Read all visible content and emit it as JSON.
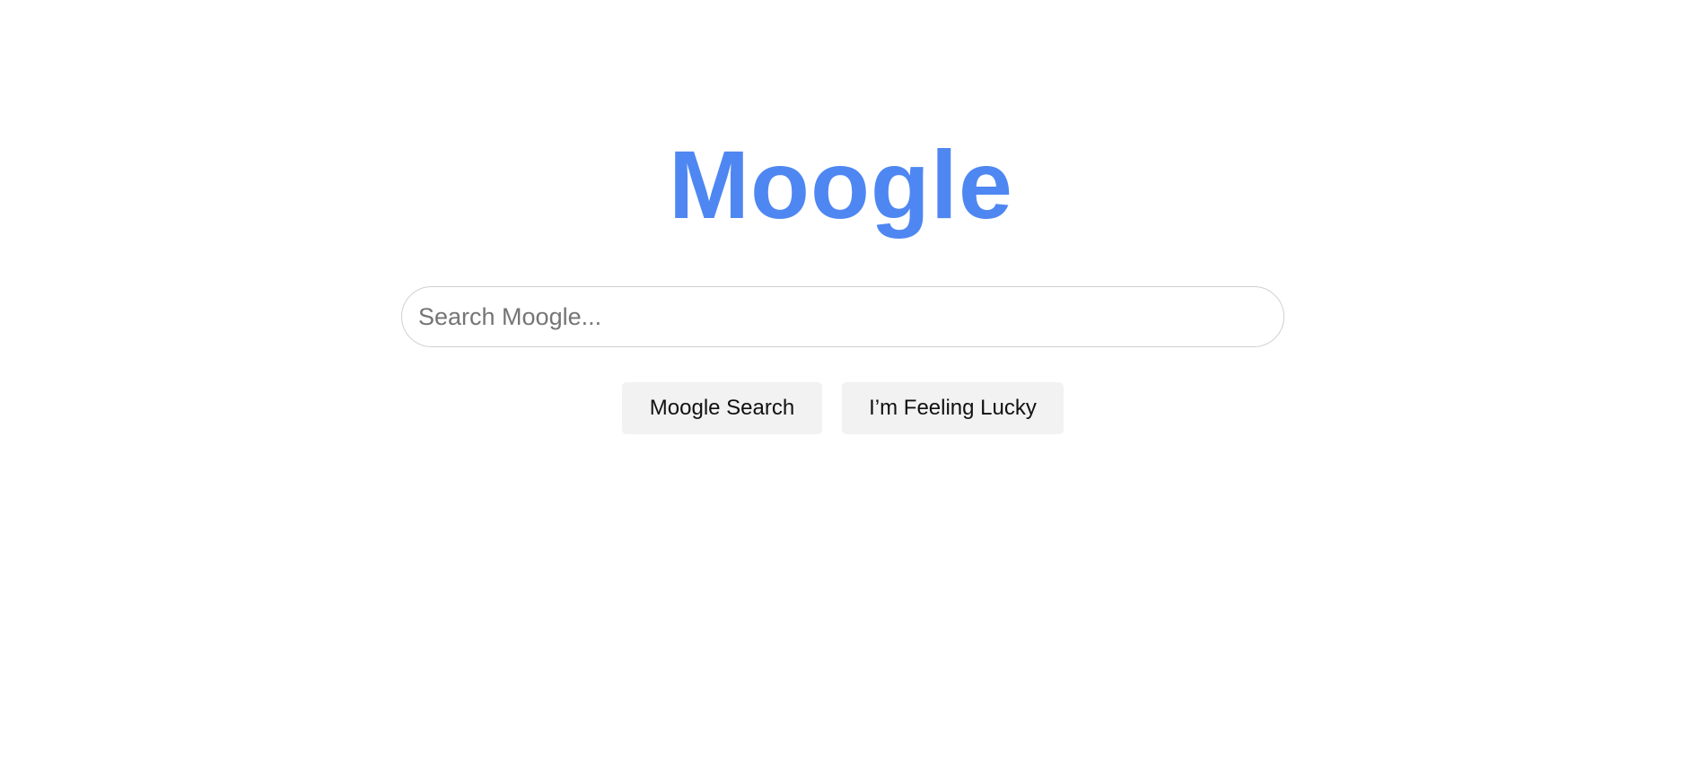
{
  "logo": {
    "text": "Moogle",
    "color": "#4f87f2"
  },
  "search": {
    "placeholder": "Search Moogle...",
    "value": ""
  },
  "buttons": {
    "search_label": "Moogle Search",
    "lucky_label": "I’m Feeling Lucky"
  }
}
